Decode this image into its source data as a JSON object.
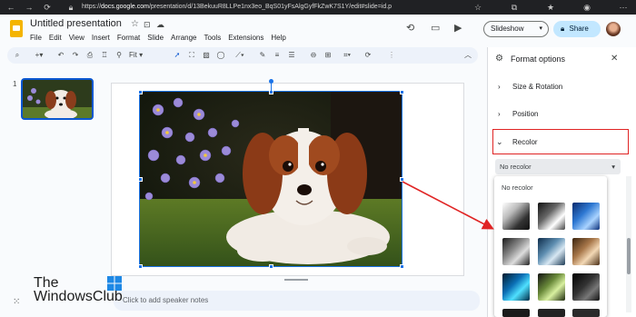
{
  "browser": {
    "url_prefix": "https://",
    "url_host": "docs.google.com",
    "url_rest": "/presentation/d/13BekuuR8LLPe1nx3eo_BqS01yFsAlgGyfFkZwK7S1Y/edit#slide=id.p"
  },
  "doc": {
    "title": "Untitled presentation",
    "menus": [
      "File",
      "Edit",
      "View",
      "Insert",
      "Format",
      "Slide",
      "Arrange",
      "Tools",
      "Extensions",
      "Help"
    ],
    "slideshow_label": "Slideshow",
    "share_label": "Share"
  },
  "toolbar": {
    "zoom_label": "Fit"
  },
  "filmstrip": {
    "slide_number": "1"
  },
  "notes": {
    "placeholder": "Click to add speaker notes"
  },
  "panel": {
    "title": "Format options",
    "sections": {
      "size_rotation": "Size & Rotation",
      "position": "Position",
      "recolor": "Recolor"
    },
    "recolor_value": "No recolor",
    "recolor_option_none": "No recolor"
  },
  "watermark": {
    "line1": "The",
    "line2": "WindowsClub"
  },
  "colors": {
    "accent": "#1a73e8",
    "highlight_box": "#e02424",
    "share_bg": "#c2e7ff"
  }
}
